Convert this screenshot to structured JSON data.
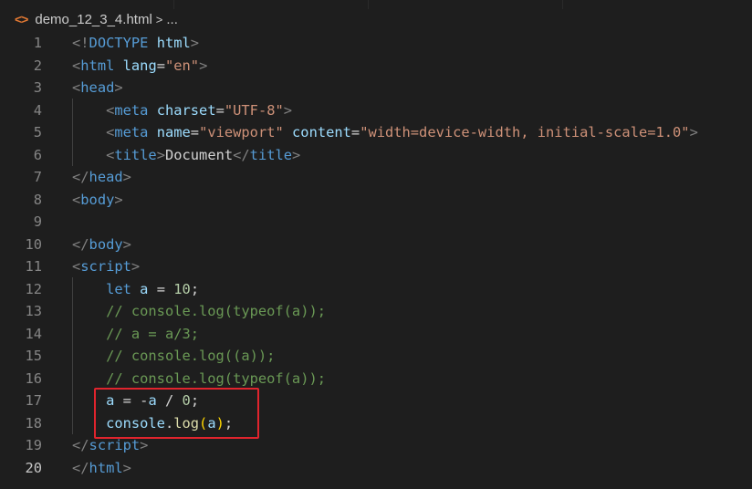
{
  "breadcrumb": {
    "filename": "demo_12_3_4.html",
    "separator": ">",
    "ellipsis": "..."
  },
  "colors": {
    "background": "#1e1e1e",
    "highlight_box": "#e0242d",
    "tag": "#569cd6",
    "attribute": "#9cdcfe",
    "string": "#ce9178",
    "comment": "#6a9955",
    "number": "#b5cea8",
    "function": "#dcdcaa",
    "bracket": "#ffd700"
  },
  "editor": {
    "active_line": 20,
    "lines": [
      {
        "number": "1",
        "tokens": [
          [
            "punct",
            "<!"
          ],
          [
            "tag",
            "DOCTYPE"
          ],
          [
            "text",
            " "
          ],
          [
            "attr",
            "html"
          ],
          [
            "punct",
            ">"
          ]
        ]
      },
      {
        "number": "2",
        "tokens": [
          [
            "punct",
            "<"
          ],
          [
            "tag",
            "html"
          ],
          [
            "text",
            " "
          ],
          [
            "attr",
            "lang"
          ],
          [
            "text",
            "="
          ],
          [
            "str",
            "\"en\""
          ],
          [
            "punct",
            ">"
          ]
        ]
      },
      {
        "number": "3",
        "tokens": [
          [
            "punct",
            "<"
          ],
          [
            "tag",
            "head"
          ],
          [
            "punct",
            ">"
          ]
        ]
      },
      {
        "number": "4",
        "tokens": [
          [
            "text",
            "    "
          ],
          [
            "punct",
            "<"
          ],
          [
            "tag",
            "meta"
          ],
          [
            "text",
            " "
          ],
          [
            "attr",
            "charset"
          ],
          [
            "text",
            "="
          ],
          [
            "str",
            "\"UTF-8\""
          ],
          [
            "punct",
            ">"
          ]
        ]
      },
      {
        "number": "5",
        "tokens": [
          [
            "text",
            "    "
          ],
          [
            "punct",
            "<"
          ],
          [
            "tag",
            "meta"
          ],
          [
            "text",
            " "
          ],
          [
            "attr",
            "name"
          ],
          [
            "text",
            "="
          ],
          [
            "str",
            "\"viewport\""
          ],
          [
            "text",
            " "
          ],
          [
            "attr",
            "content"
          ],
          [
            "text",
            "="
          ],
          [
            "str",
            "\"width=device-width, initial-scale=1.0\""
          ],
          [
            "punct",
            ">"
          ]
        ]
      },
      {
        "number": "6",
        "tokens": [
          [
            "text",
            "    "
          ],
          [
            "punct",
            "<"
          ],
          [
            "tag",
            "title"
          ],
          [
            "punct",
            ">"
          ],
          [
            "text",
            "Document"
          ],
          [
            "punct",
            "</"
          ],
          [
            "tag",
            "title"
          ],
          [
            "punct",
            ">"
          ]
        ]
      },
      {
        "number": "7",
        "tokens": [
          [
            "punct",
            "</"
          ],
          [
            "tag",
            "head"
          ],
          [
            "punct",
            ">"
          ]
        ]
      },
      {
        "number": "8",
        "tokens": [
          [
            "punct",
            "<"
          ],
          [
            "tag",
            "body"
          ],
          [
            "punct",
            ">"
          ]
        ]
      },
      {
        "number": "9",
        "tokens": []
      },
      {
        "number": "10",
        "tokens": [
          [
            "punct",
            "</"
          ],
          [
            "tag",
            "body"
          ],
          [
            "punct",
            ">"
          ]
        ]
      },
      {
        "number": "11",
        "tokens": [
          [
            "punct",
            "<"
          ],
          [
            "tag",
            "script"
          ],
          [
            "punct",
            ">"
          ]
        ]
      },
      {
        "number": "12",
        "tokens": [
          [
            "text",
            "    "
          ],
          [
            "kw",
            "let"
          ],
          [
            "text",
            " "
          ],
          [
            "var",
            "a"
          ],
          [
            "op",
            " = "
          ],
          [
            "num",
            "10"
          ],
          [
            "text",
            ";"
          ]
        ]
      },
      {
        "number": "13",
        "tokens": [
          [
            "text",
            "    "
          ],
          [
            "comment",
            "// console.log(typeof(a));"
          ]
        ]
      },
      {
        "number": "14",
        "tokens": [
          [
            "text",
            "    "
          ],
          [
            "comment",
            "// a = a/3;"
          ]
        ]
      },
      {
        "number": "15",
        "tokens": [
          [
            "text",
            "    "
          ],
          [
            "comment",
            "// console.log((a));"
          ]
        ]
      },
      {
        "number": "16",
        "tokens": [
          [
            "text",
            "    "
          ],
          [
            "comment",
            "// console.log(typeof(a));"
          ]
        ]
      },
      {
        "number": "17",
        "tokens": [
          [
            "text",
            "    "
          ],
          [
            "var",
            "a"
          ],
          [
            "op",
            " = -"
          ],
          [
            "var",
            "a"
          ],
          [
            "op",
            " / "
          ],
          [
            "num",
            "0"
          ],
          [
            "text",
            ";"
          ]
        ]
      },
      {
        "number": "18",
        "tokens": [
          [
            "text",
            "    "
          ],
          [
            "var",
            "console"
          ],
          [
            "text",
            "."
          ],
          [
            "fn",
            "log"
          ],
          [
            "paren",
            "("
          ],
          [
            "var",
            "a"
          ],
          [
            "paren",
            ")"
          ],
          [
            "text",
            ";"
          ]
        ]
      },
      {
        "number": "19",
        "tokens": [
          [
            "punct",
            "</"
          ],
          [
            "tag",
            "script"
          ],
          [
            "punct",
            ">"
          ]
        ]
      },
      {
        "number": "20",
        "tokens": [
          [
            "punct",
            "</"
          ],
          [
            "tag",
            "html"
          ],
          [
            "punct",
            ">"
          ]
        ]
      }
    ]
  }
}
